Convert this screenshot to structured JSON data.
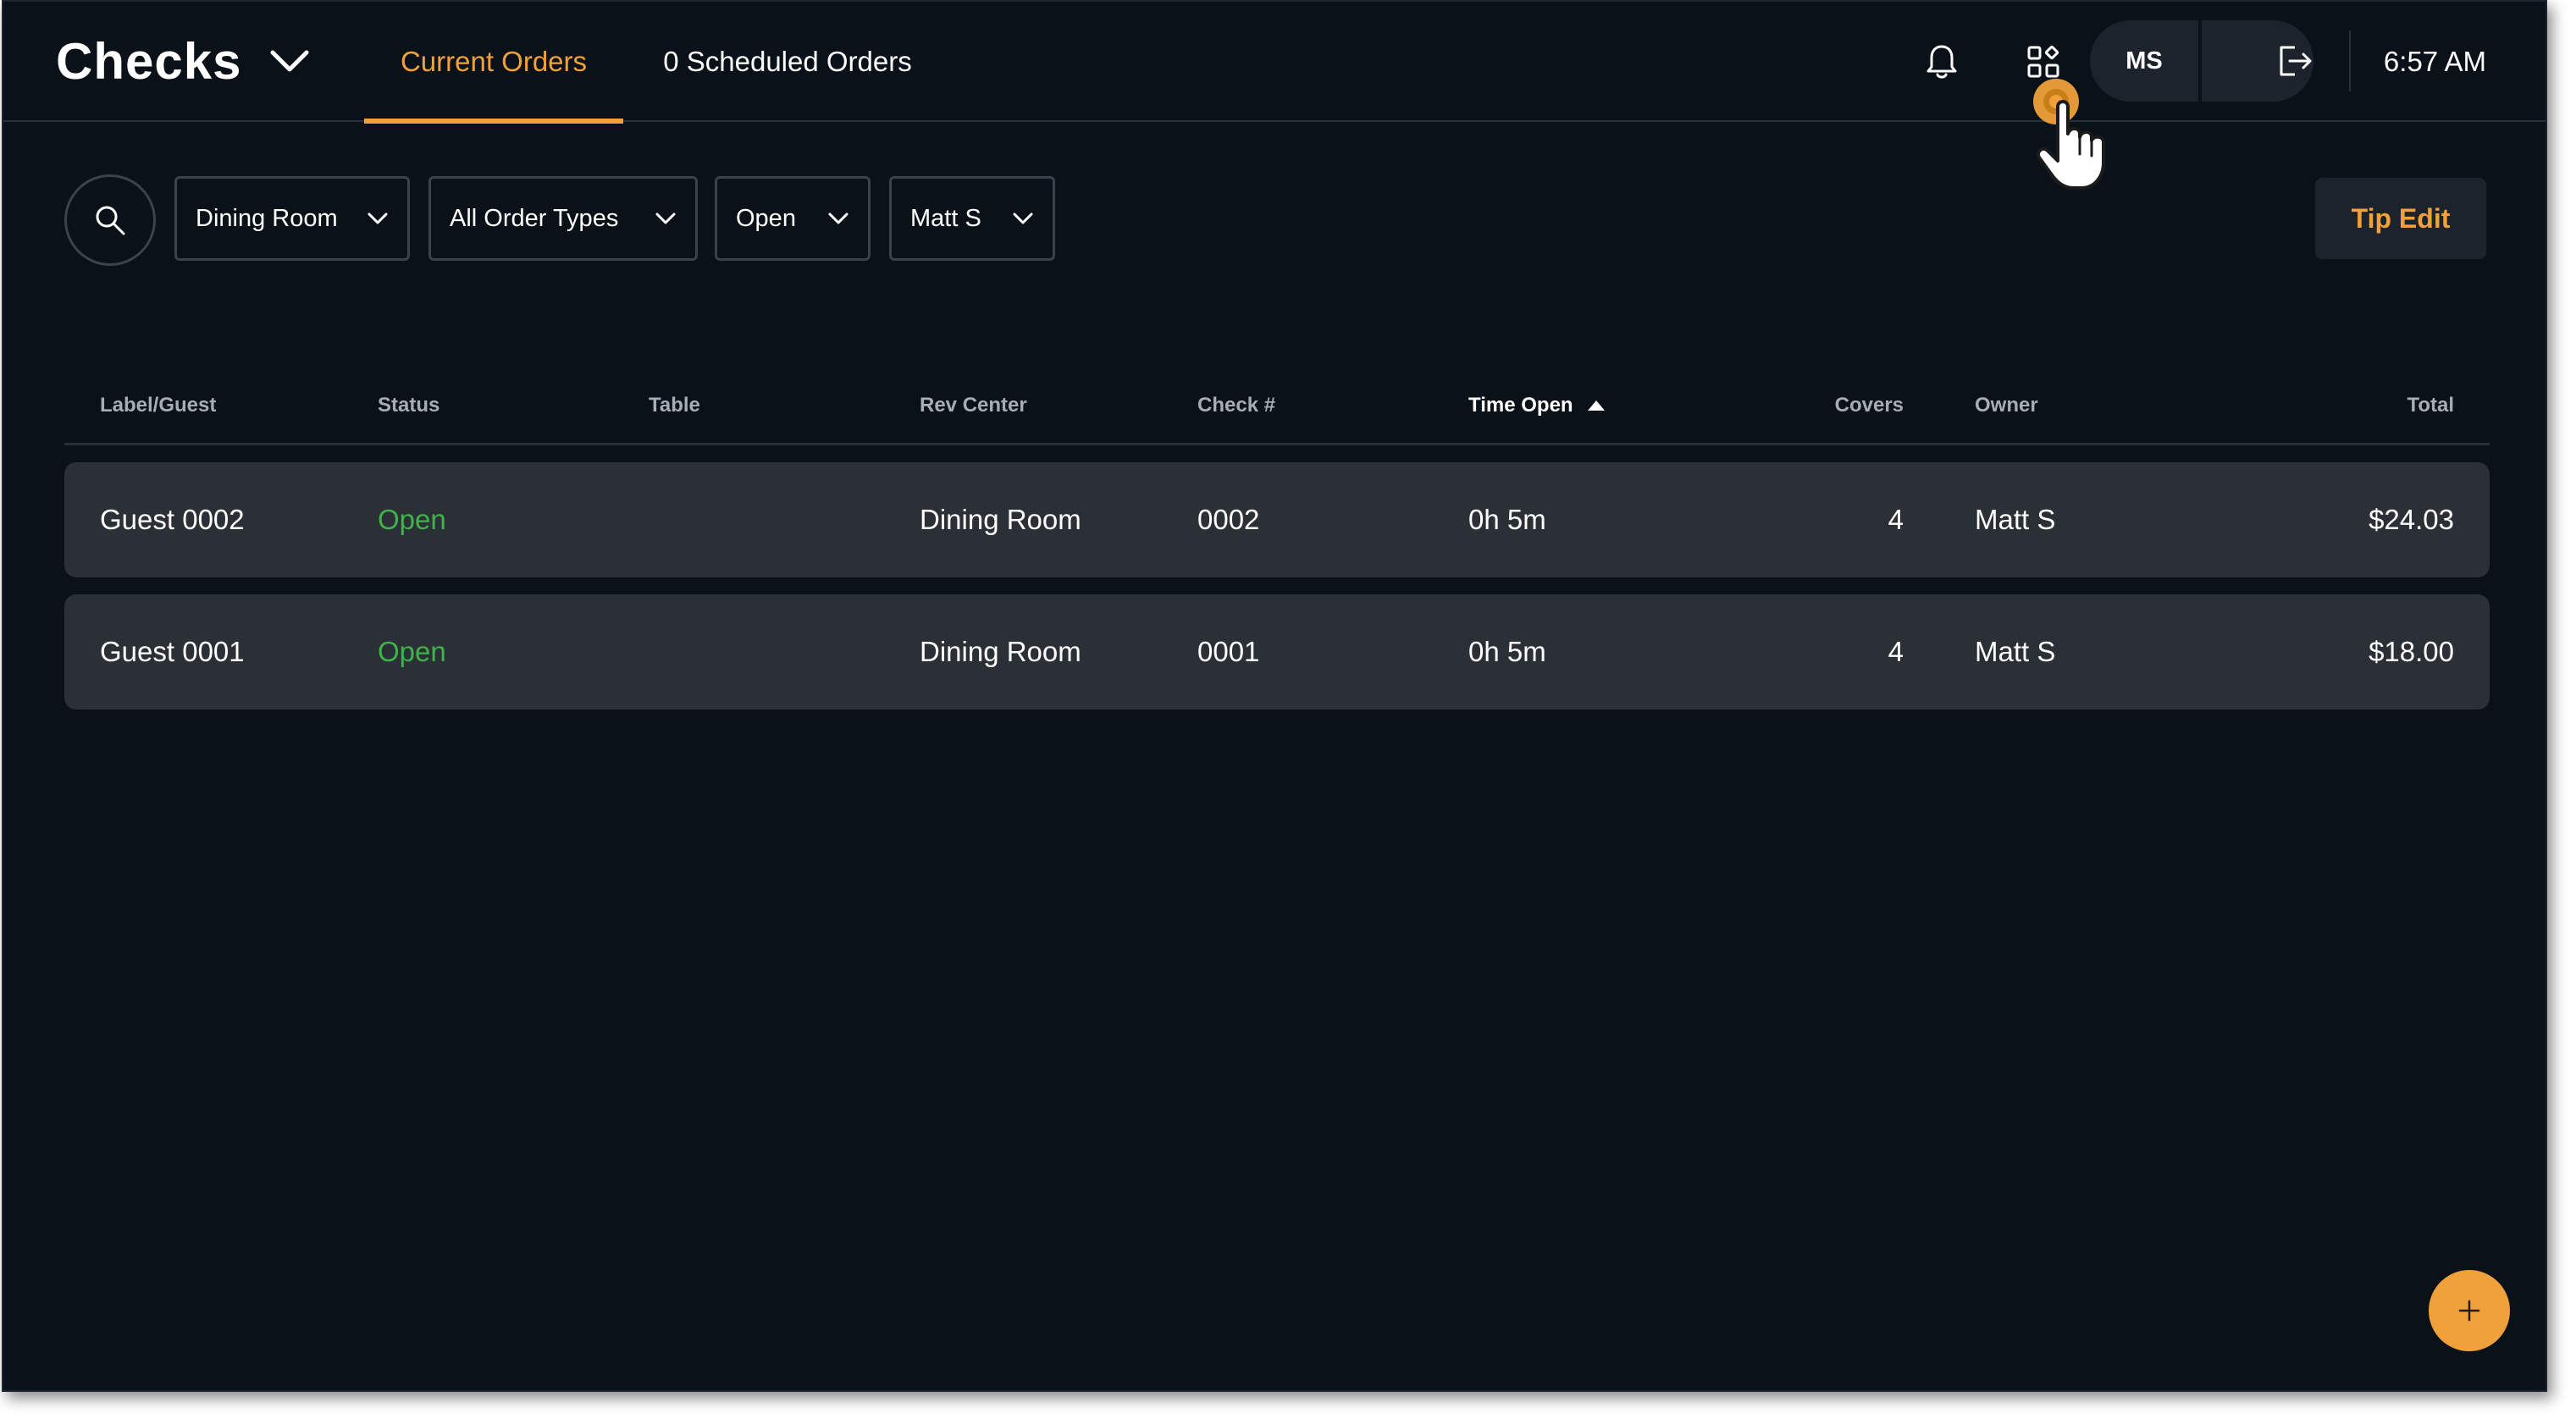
{
  "app": {
    "title": "Checks"
  },
  "tabs": [
    {
      "label": "Current Orders",
      "active": true
    },
    {
      "label": "0 Scheduled Orders",
      "active": false
    }
  ],
  "header": {
    "user_initials": "MS",
    "time": "6:57 AM",
    "icons": [
      "bell-icon",
      "apps-grid-icon",
      "logout-icon"
    ]
  },
  "filters": {
    "rev_center": "Dining Room",
    "order_type": "All Order Types",
    "status": "Open",
    "owner": "Matt S"
  },
  "actions": {
    "tip_edit": "Tip Edit",
    "add": "+"
  },
  "table": {
    "columns": [
      "Label/Guest",
      "Status",
      "Table",
      "Rev Center",
      "Check #",
      "Time Open",
      "Covers",
      "Owner",
      "Total"
    ],
    "sort": {
      "column": "Time Open",
      "direction": "ascending"
    },
    "rows": [
      {
        "guest": "Guest 0002",
        "status": "Open",
        "table": "",
        "rev_center": "Dining Room",
        "check": "0002",
        "time_open": "0h 5m",
        "covers": "4",
        "owner": "Matt S",
        "total": "$24.03"
      },
      {
        "guest": "Guest 0001",
        "status": "Open",
        "table": "",
        "rev_center": "Dining Room",
        "check": "0001",
        "time_open": "0h 5m",
        "covers": "4",
        "owner": "Matt S",
        "total": "$18.00"
      }
    ]
  },
  "colors": {
    "background": "#0b1119",
    "accent": "#f0a13a",
    "status_open": "#3fb34a",
    "row_bg": "#2b2f36",
    "surface": "#1c232c"
  }
}
